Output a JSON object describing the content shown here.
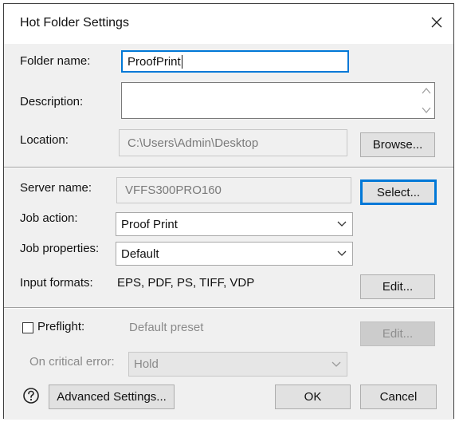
{
  "dialog": {
    "title": "Hot Folder Settings",
    "close_icon": "close-icon"
  },
  "folder": {
    "name_label": "Folder name:",
    "name_value": "ProofPrint",
    "description_label": "Description:",
    "description_value": "",
    "location_label": "Location:",
    "location_value": "C:\\Users\\Admin\\Desktop",
    "browse_label": "Browse..."
  },
  "server": {
    "server_name_label": "Server name:",
    "server_name_value": "VFFS300PRO160",
    "select_label": "Select...",
    "job_action_label": "Job action:",
    "job_action_value": "Proof Print",
    "job_properties_label": "Job properties:",
    "job_properties_value": "Default",
    "input_formats_label": "Input formats:",
    "input_formats_value": "EPS, PDF, PS, TIFF, VDP",
    "edit_formats_label": "Edit..."
  },
  "preflight": {
    "checkbox_label": "Preflight:",
    "checked": false,
    "preset_value": "Default preset",
    "edit_label": "Edit...",
    "critical_error_label": "On critical error:",
    "critical_error_value": "Hold"
  },
  "footer": {
    "help_icon": "question-circle-icon",
    "advanced_label": "Advanced Settings...",
    "ok_label": "OK",
    "cancel_label": "Cancel"
  },
  "colors": {
    "focus_accent": "#0078d7",
    "section_background": "#f0f0f0",
    "disabled_text": "#8a8a8a"
  }
}
